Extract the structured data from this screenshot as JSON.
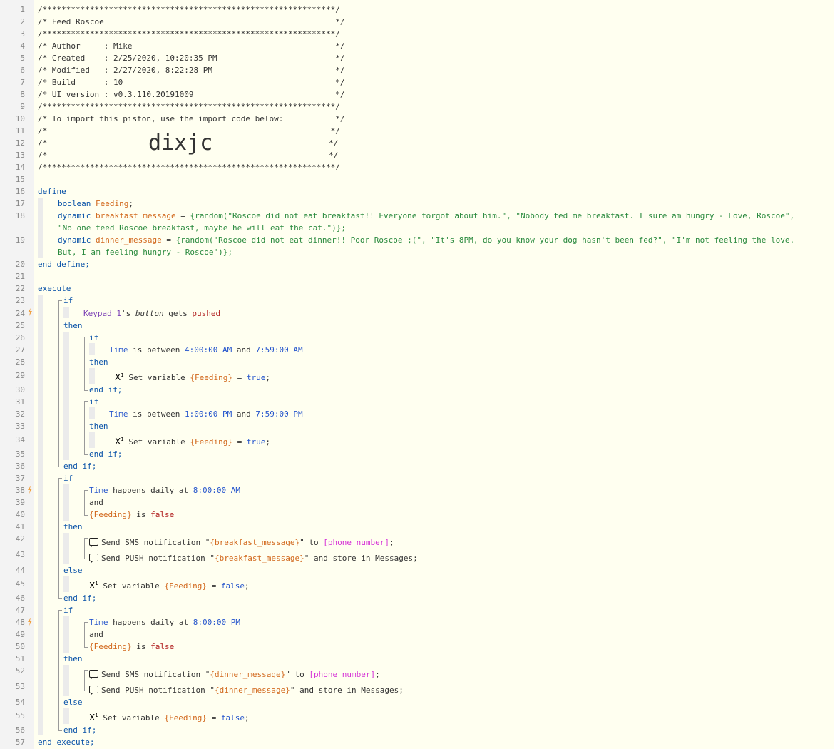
{
  "line_numbers": [
    "1",
    "2",
    "3",
    "4",
    "5",
    "6",
    "7",
    "8",
    "9",
    "10",
    "11",
    "12",
    "13",
    "14",
    "15",
    "16",
    "17",
    "18",
    "19",
    "20",
    "21",
    "22",
    "23",
    "24",
    "25",
    "26",
    "27",
    "28",
    "29",
    "30",
    "31",
    "32",
    "33",
    "34",
    "35",
    "36",
    "37",
    "38",
    "39",
    "40",
    "41",
    "42",
    "43",
    "44",
    "45",
    "46",
    "47",
    "48",
    "49",
    "50",
    "51",
    "52",
    "53",
    "54",
    "55",
    "56",
    "57"
  ],
  "header": {
    "border": "/**************************************************************/",
    "title_line": "/* Feed Roscoe                                                 */",
    "author_line": "/* Author     : Mike                                           */",
    "created_line": "/* Created    : 2/25/2020, 10:20:35 PM                         */",
    "modified_line": "/* Modified   : 2/27/2020, 8:22:28 PM                          */",
    "build_line": "/* Build      : 10                                             */",
    "ui_line": "/* UI version : v0.3.110.20191009                              */",
    "import_line": "/* To import this piston, use the import code below:           */",
    "empty_line": "/*                                                            */",
    "blank_open": "/*",
    "blank_close": "*/",
    "import_code": "dixjc"
  },
  "define": {
    "start": "define",
    "end": "end define;",
    "type_boolean": "boolean",
    "var_feeding": "Feeding",
    "type_dynamic": "dynamic",
    "var_breakfast": "breakfast_message",
    "var_dinner": "dinner_message",
    "breakfast_value_1": "{random(\"Roscoe did not eat breakfast!! Everyone forgot about him.\", \"Nobody fed me breakfast. I sure am hungry - Love, Roscoe\",",
    "breakfast_value_2": "\"No one feed Roscoe breakfast, maybe he will eat the cat.\")};",
    "dinner_value_1": "{random(\"Roscoe did not eat dinner!! Poor Roscoe ;(\", \"It's 8PM, do you know your dog hasn't been fed?\", \"I'm not feeling the love.",
    "dinner_value_2": "But, I am feeling hungry - Roscoe\")};"
  },
  "execute": {
    "start": "execute",
    "end": "end execute;",
    "kw_if": "if",
    "kw_then": "then",
    "kw_else": "else",
    "kw_end_if": "end if;",
    "kw_and": "and",
    "keypad_device": "Keypad 1",
    "keypad_suffix": "'s ",
    "keypad_attr": "button",
    "keypad_op": " gets ",
    "keypad_value": "pushed",
    "time_attr": "Time",
    "is_between": " is between ",
    "and_word": " and ",
    "range1_from": "4:00:00 AM",
    "range1_to": "7:59:00 AM",
    "range2_from": "1:00:00 PM",
    "range2_to": "7:59:00 PM",
    "happens_daily": " happens daily at ",
    "trigger_morning": "8:00:00 AM",
    "trigger_evening": "8:00:00 PM",
    "feeding_ref": "{Feeding}",
    "is_word": " is ",
    "false_word": "false",
    "true_word": "true",
    "set_variable": "Set variable ",
    "equals": " = ",
    "semicolon": ";",
    "send_sms": "Send SMS notification \"",
    "send_push": "Send PUSH notification \"",
    "breakfast_ref": "{breakfast_message}",
    "dinner_ref": "{dinner_message}",
    "to_word": "\" to ",
    "phone": "[phone number]",
    "store_suffix": "\" and store in Messages;",
    "x1_label": "X"
  },
  "colors": {
    "keyword": "#0a53a8",
    "string": "#2a8a3e",
    "variable": "#d2691e",
    "value": "#2555cc",
    "device": "#7b3fb5",
    "false": "#b22222",
    "trigger_bolt": "#f0a040"
  },
  "icons": {
    "trigger": "lightning-bolt-icon",
    "set_variable": "x1-variable-icon",
    "notification": "speech-bubble-icon"
  }
}
